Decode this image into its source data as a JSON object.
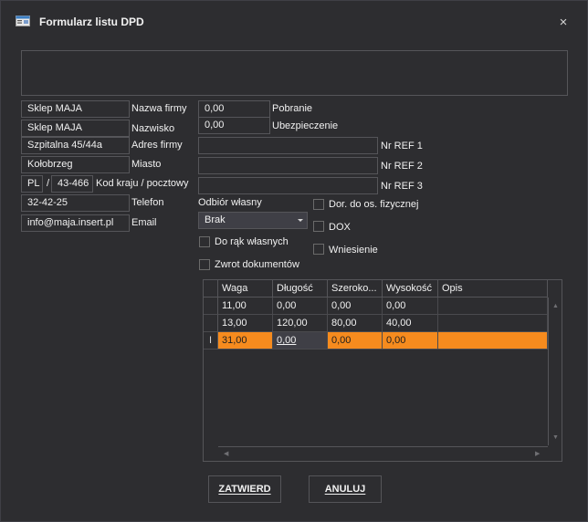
{
  "window": {
    "title": "Formularz listu DPD",
    "close_glyph": "×"
  },
  "receiver": {
    "company_value": "Sklep MAJA",
    "company_label": "Nazwa firmy",
    "surname_value": "Sklep MAJA",
    "surname_label": "Nazwisko",
    "address_value": "Szpitalna 45/44a",
    "address_label": "Adres firmy",
    "city_value": "Kołobrzeg",
    "city_label": "Miasto",
    "country_value": "PL",
    "slash": "/",
    "postal_value": "43-466",
    "postal_label": "Kod kraju / pocztowy",
    "phone_value": "32-42-25",
    "phone_label": "Telefon",
    "email_value": "info@maja.insert.pl",
    "email_label": "Email"
  },
  "options": {
    "cod_value": "0,00",
    "cod_label": "Pobranie",
    "insurance_value": "0,00",
    "insurance_label": "Ubezpieczenie",
    "pickup_label": "Odbiór własny",
    "pickup_select_value": "Brak",
    "own_hands_label": "Do rąk własnych",
    "return_docs_label": "Zwrot dokumentów",
    "ref1_label": "Nr REF 1",
    "ref2_label": "Nr REF 2",
    "ref3_label": "Nr REF 3",
    "private_person_label": "Dor. do os. fizycznej",
    "dox_label": "DOX",
    "carry_in_label": "Wniesienie"
  },
  "grid": {
    "columns": [
      "Waga",
      "Długość",
      "Szeroko...",
      "Wysokość",
      "Opis"
    ],
    "rows": [
      [
        "11,00",
        "0,00",
        "0,00",
        "0,00",
        ""
      ],
      [
        "13,00",
        "120,00",
        "80,00",
        "40,00",
        ""
      ],
      [
        "31,00",
        "0,00",
        "0,00",
        "0,00",
        ""
      ]
    ],
    "selected_row": 2,
    "edit_cursor_glyph": "I"
  },
  "buttons": {
    "confirm_label": "ZATWIERD",
    "cancel_label": "ANULUJ"
  },
  "colors": {
    "background": "#2d2d30",
    "accent_selection": "#f68b1e",
    "border": "#555559"
  }
}
